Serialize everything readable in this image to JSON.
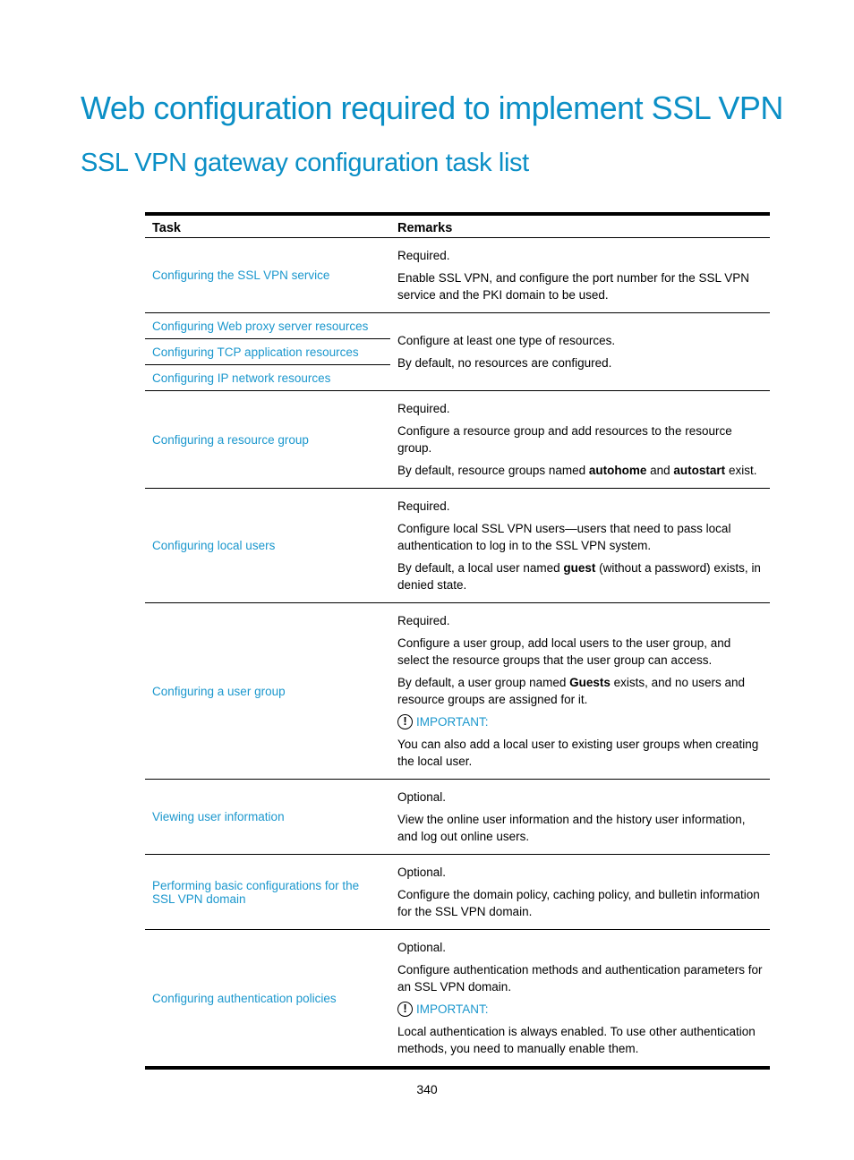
{
  "heading1": "Web configuration required to implement SSL VPN",
  "heading2": "SSL VPN gateway configuration task list",
  "table": {
    "headers": {
      "task": "Task",
      "remarks": "Remarks"
    },
    "rows": [
      {
        "task": "Configuring the SSL VPN service",
        "remarks": [
          "Required.",
          "Enable SSL VPN, and configure the port number for the SSL VPN service and the PKI domain to be used."
        ]
      },
      {
        "tasks": [
          "Configuring Web proxy server resources",
          "Configuring TCP application resources",
          "Configuring IP network resources"
        ],
        "remarks": [
          "Configure at least one type of resources.",
          "By default, no resources are configured."
        ]
      },
      {
        "task": "Configuring a resource group",
        "remarks": [
          "Required.",
          "Configure a resource group and add resources to the resource group."
        ],
        "remark_rich": {
          "before": "By default, resource groups named ",
          "bold1": "autohome",
          "middle": " and ",
          "bold2": "autostart",
          "after": " exist."
        }
      },
      {
        "task": "Configuring local users",
        "remarks": [
          "Required.",
          "Configure local SSL VPN users—users that need to pass local authentication to log in to the SSL VPN system."
        ],
        "remark_rich": {
          "before": "By default, a local user named ",
          "bold1": "guest",
          "after": " (without a password) exists, in denied state."
        }
      },
      {
        "task": "Configuring a user group",
        "remarks": [
          "Required.",
          "Configure a user group, add local users to the user group, and select the resource groups that the user group can access."
        ],
        "remark_rich": {
          "before": "By default, a user group named ",
          "bold1": "Guests",
          "after": " exists, and no users and resource groups are assigned for it."
        },
        "important_label": "IMPORTANT:",
        "important_text": "You can also add a local user to existing user groups when creating the local user."
      },
      {
        "task": "Viewing user information",
        "remarks": [
          "Optional.",
          "View the online user information and the history user information, and log out online users."
        ]
      },
      {
        "task": "Performing basic configurations for the SSL VPN domain",
        "remarks": [
          "Optional.",
          "Configure the domain policy, caching policy, and bulletin information for the SSL VPN domain."
        ]
      },
      {
        "task": "Configuring authentication policies",
        "remarks": [
          "Optional.",
          "Configure authentication methods and authentication parameters for an SSL VPN domain."
        ],
        "important_label": "IMPORTANT:",
        "important_text": "Local authentication is always enabled. To use other authentication methods, you need to manually enable them."
      }
    ]
  },
  "icons": {
    "important": "exclamation-circle-icon"
  },
  "colors": {
    "heading": "#0b8fc6",
    "link": "#1b97cd",
    "text": "#000000"
  },
  "page_number": "340"
}
